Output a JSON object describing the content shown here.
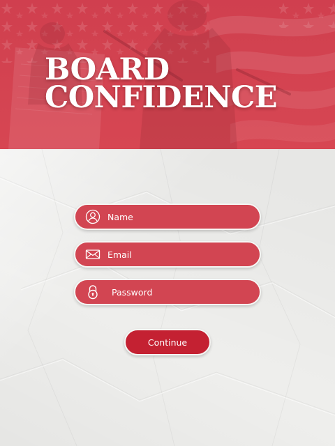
{
  "header": {
    "title_line1": "BOARD",
    "title_line2": "CONFIDENCE"
  },
  "form": {
    "name_placeholder": "Name",
    "email_placeholder": "Email",
    "password_placeholder": "Password",
    "continue_label": "Continue"
  },
  "icons": {
    "name": "user-circle-icon",
    "email": "envelope-icon",
    "password": "padlock-icon"
  },
  "colors": {
    "banner_red": "#d1444f",
    "field_red": "#d24552",
    "button_red": "#c42132",
    "background": "#eeeeec",
    "text": "#ffffff"
  }
}
